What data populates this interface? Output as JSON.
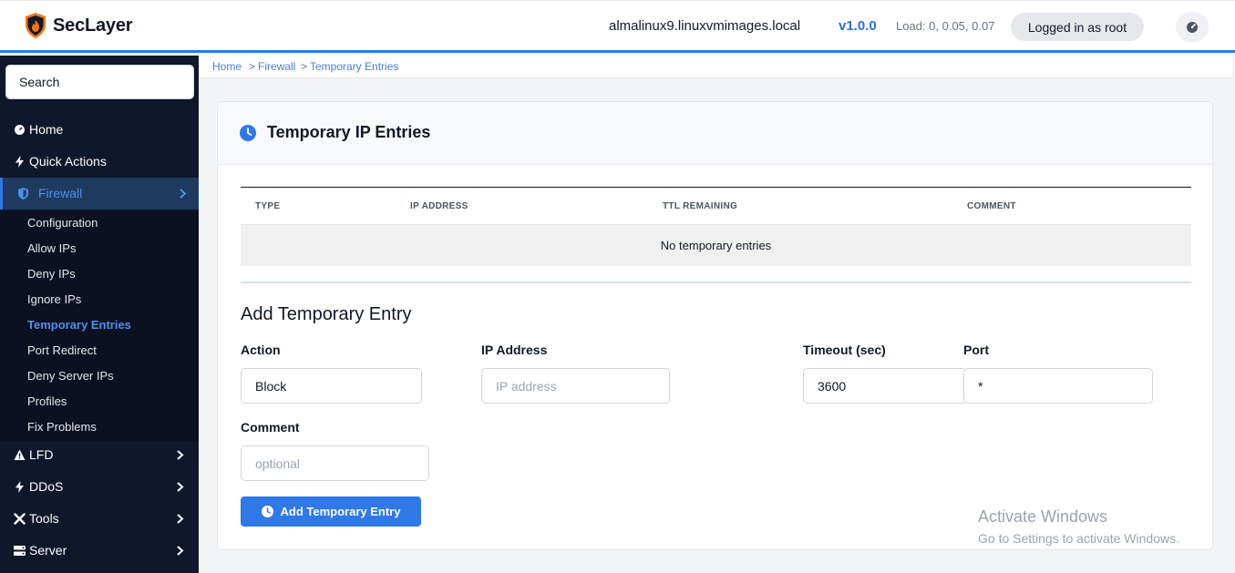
{
  "header": {
    "brand": "SecLayer",
    "hostname": "almalinux9.linuxvmimages.local",
    "version": "v1.0.0",
    "load": "Load: 0, 0.05, 0.07",
    "login": "Logged in as root",
    "accent_color": "#2f78e6"
  },
  "sidebar": {
    "search_label": "Search",
    "items": [
      {
        "label": "Home",
        "icon": "gauge-icon"
      },
      {
        "label": "Quick Actions",
        "icon": "bolt-icon"
      },
      {
        "label": "Firewall",
        "icon": "shield-icon",
        "active": true
      },
      {
        "label": "LFD",
        "icon": "warning-icon"
      },
      {
        "label": "DDoS",
        "icon": "bolt-icon"
      },
      {
        "label": "Tools",
        "icon": "tools-icon"
      },
      {
        "label": "Server",
        "icon": "server-icon"
      }
    ],
    "firewall_sub": [
      "Configuration",
      "Allow IPs",
      "Deny IPs",
      "Ignore IPs",
      "Temporary Entries",
      "Port Redirect",
      "Deny Server IPs",
      "Profiles",
      "Fix Problems"
    ]
  },
  "breadcrumb": {
    "home": "Home",
    "section": "Firewall",
    "current": "Temporary Entries",
    "sep": ">"
  },
  "card": {
    "title": "Temporary IP Entries",
    "table": {
      "columns": [
        "TYPE",
        "IP ADDRESS",
        "TTL REMAINING",
        "COMMENT"
      ],
      "empty_text": "No temporary entries"
    },
    "form": {
      "title": "Add Temporary Entry",
      "action_label": "Action",
      "action_value": "Block",
      "ip_label": "IP Address",
      "ip_placeholder": "IP address",
      "timeout_label": "Timeout (sec)",
      "timeout_value": "3600",
      "port_label": "Port",
      "port_value": "*",
      "comment_label": "Comment",
      "comment_placeholder": "optional",
      "submit_label": "Add Temporary Entry"
    }
  },
  "watermark": {
    "line1": "Activate Windows",
    "line2": "Go to Settings to activate Windows."
  }
}
